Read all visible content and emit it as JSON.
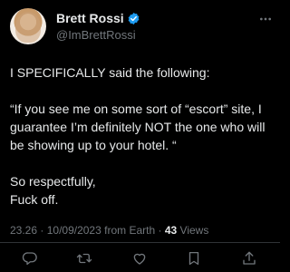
{
  "author": {
    "display_name": "Brett Rossi",
    "handle": "@ImBrettRossi",
    "verified": true
  },
  "tweet": {
    "line1": "I SPECIFICALLY said the following:",
    "line2": "“If you see me on some sort of “escort” site, I guarantee I’m definitely NOT the one who will be showing up to your hotel. “",
    "line3a": "So respectfully,",
    "line3b": "Fuck off."
  },
  "meta": {
    "time": "23.26",
    "date": "10/09/2023",
    "source": "from Earth",
    "views_count": "43",
    "views_label": "Views"
  },
  "colors": {
    "background": "#000000",
    "text": "#e7e9ea",
    "muted": "#71767b",
    "verified_blue": "#1d9bf0"
  },
  "icons": [
    "more-icon",
    "reply-icon",
    "retweet-icon",
    "like-icon",
    "bookmark-icon",
    "share-icon"
  ]
}
